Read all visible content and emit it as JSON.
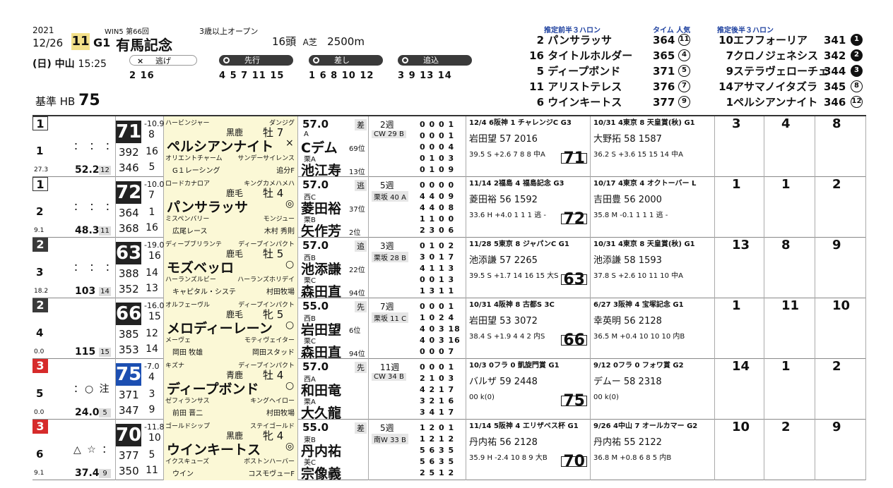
{
  "header": {
    "year": "2021",
    "date": "12/26",
    "win5": "WIN5",
    "win5_count": "第66回",
    "race_number": "11",
    "grade": "G1",
    "race_name": "有馬記念",
    "condition": "3歳以上オープン",
    "field": "16頭",
    "surface": "A芝",
    "distance": "2500m",
    "venue": "(日) 中山",
    "post_time": "15:25",
    "basis_label": "基準 HB",
    "basis_value": "75"
  },
  "styles": [
    {
      "label": "逃げ",
      "runners": "2  16"
    },
    {
      "label": "先行",
      "runners": "4  5  7  11 15"
    },
    {
      "label": "差し",
      "runners": "1  6  8  10 12"
    },
    {
      "label": "追込",
      "runners": "3  9  13 14"
    }
  ],
  "early_pace": {
    "heading": "推定前半３ハロン",
    "rows": [
      {
        "no": "2",
        "name": "パンサラッサ"
      },
      {
        "no": "16",
        "name": "タイトルホルダー"
      },
      {
        "no": "5",
        "name": "ディープボンド"
      },
      {
        "no": "11",
        "name": "アリストテレス"
      },
      {
        "no": "6",
        "name": "ウインキートス"
      }
    ]
  },
  "time_pop": {
    "heading": "タイム 人気",
    "rows": [
      {
        "time": "364",
        "pop": "11"
      },
      {
        "time": "365",
        "pop": "4"
      },
      {
        "time": "371",
        "pop": "5"
      },
      {
        "time": "376",
        "pop": "7"
      },
      {
        "time": "377",
        "pop": "9"
      }
    ]
  },
  "late_pace": {
    "heading": "推定後半３ハロン",
    "rows": [
      {
        "no": "10",
        "name": "エフフォーリア",
        "time": "341",
        "rank": "1"
      },
      {
        "no": "7",
        "name": "クロノジェネシス",
        "time": "342",
        "rank": "2"
      },
      {
        "no": "9",
        "name": "ステラヴェローチェ",
        "time": "344",
        "rank": "3"
      },
      {
        "no": "14",
        "name": "アサマノイタズラ",
        "time": "345",
        "rank": "8"
      },
      {
        "no": "1",
        "name": "ペルシアンナイト",
        "time": "346",
        "rank": "12"
      }
    ]
  },
  "colors": {
    "waku1": "#ffffff",
    "waku2": "#3a3a3a",
    "waku3": "#d62b2b",
    "waku4": "#1c4fb2",
    "highlight": "#fbf8d6"
  },
  "horses": [
    {
      "waku": "1",
      "no": "1",
      "marks": "： ： ：",
      "odds": "52.2",
      "pop": "12",
      "odds_idx": "27.3",
      "rating": "71",
      "r1": "-10.9",
      "r1b": "8",
      "r2": "392",
      "r2b": "16",
      "r3": "346",
      "r3b": "5",
      "sire": "ハービンジャー",
      "dam_sire": "ダンジグ",
      "coat": "黒鹿",
      "sex_age": "牡 7",
      "name": "ペルシアンナイト",
      "mark": "×",
      "dam": "オリエントチャーム",
      "owner_sire": "サンデーサイレンス",
      "owner": "G１レーシング",
      "breeder": "追分F",
      "weight": "57.0",
      "style": "差",
      "jockey_pre": "A",
      "jockey": "Cデム",
      "j_rank": "69位",
      "trainer_pre": "栗A",
      "trainer": "池江寿",
      "t_rank": "13位",
      "interval": "2週",
      "course": "CW 29 B",
      "rec": [
        "0 0 0 1",
        "0 0 0 1",
        "0 0 0 4",
        "0 1 0 3",
        "0 1 0 9"
      ],
      "past1": "12/4 6阪神 1 チャレンジC G3",
      "past1b": "岩田望 57 2016",
      "past1c": "39.5 S +2.6 7 8 8 中A",
      "past2": "10/31 4東京 8 天皇賞(秋) G1",
      "past2b": "大野拓 58 1587",
      "past2c": "36.2 S +3.6 15 15 14 中A",
      "f1": "3",
      "f2": "4",
      "f3": "8"
    },
    {
      "waku": "1",
      "no": "2",
      "marks": "： ： ：",
      "odds": "48.3",
      "pop": "11",
      "odds_idx": "9.1",
      "rating": "72",
      "r1": "-10.0",
      "r1b": "7",
      "r2": "364",
      "r2b": "1",
      "r3": "368",
      "r3b": "16",
      "sire": "ロードカナロア",
      "dam_sire": "キングカメハメハ",
      "coat": "鹿毛",
      "sex_age": "牡 4",
      "name": "パンサラッサ",
      "mark": "◎",
      "dam": "ミスペンバリー",
      "owner_sire": "モンジュー",
      "owner": "広尾レース",
      "breeder": "木村 秀則",
      "weight": "57.0",
      "style": "逃",
      "jockey_pre": "西C",
      "jockey": "菱田裕",
      "j_rank": "37位",
      "trainer_pre": "栗B",
      "trainer": "矢作芳",
      "t_rank": "2位",
      "interval": "5週",
      "course": "栗坂 40 A",
      "rec": [
        "0 0 0 0",
        "4 4 0 9",
        "4 4 0 8",
        "1 1 0 0",
        "2 3 0 6"
      ],
      "past1": "11/14 2福島 4 福島記念 G3",
      "past1b": "菱田裕 56 1592",
      "past1c": "33.6 H +4.0 1 1 1 逃 -",
      "past2": "10/17 4東京 4 オクトーバー L",
      "past2b": "吉田豊 56 2000",
      "past2c": "35.8 M -0.1 1 1 1 逃 -",
      "f1": "1",
      "f2": "1",
      "f3": "2"
    },
    {
      "waku": "2",
      "no": "3",
      "marks": "： ： ：",
      "odds": "103",
      "pop": "14",
      "odds_idx": "18.2",
      "rating": "63",
      "r1": "-19.0",
      "r1b": "16",
      "r2": "388",
      "r2b": "14",
      "r3": "352",
      "r3b": "13",
      "sire": "ディープブリランテ",
      "dam_sire": "ディープインパクト",
      "coat": "鹿毛",
      "sex_age": "牡 5",
      "name": "モズベッロ",
      "mark": "○",
      "dam": "ハーランズルビー",
      "owner_sire": "ハーランズホリデイ",
      "owner": "キャピタル・システ",
      "breeder": "村田牧場",
      "weight": "57.0",
      "style": "追",
      "jockey_pre": "西B",
      "jockey": "池添謙",
      "j_rank": "22位",
      "trainer_pre": "栗C",
      "trainer": "森田直",
      "t_rank": "94位",
      "interval": "3週",
      "course": "栗坂 28 B",
      "rec": [
        "0 1 0 2",
        "3 0 1 7",
        "4 1 1 3",
        "0 0 1 3",
        "1 3 1 1"
      ],
      "past1": "11/28 5東京 8 ジャパンC G1",
      "past1b": "池添謙 57 2265",
      "past1c": "39.5 S +1.7 14 16 15 大S",
      "past2": "10/31 4東京 8 天皇賞(秋) G1",
      "past2b": "池添謙 58 1593",
      "past2c": "37.8 S +2.6 10 11 10 中A",
      "f1": "13",
      "f2": "8",
      "f3": "9"
    },
    {
      "waku": "2",
      "no": "4",
      "marks": "",
      "odds": "115",
      "pop": "15",
      "odds_idx": "0.0",
      "rating": "66",
      "r1": "-16.0",
      "r1b": "15",
      "r2": "385",
      "r2b": "12",
      "r3": "353",
      "r3b": "14",
      "sire": "オルフェーヴル",
      "dam_sire": "ディープインパクト",
      "coat": "鹿毛",
      "sex_age": "牝 5",
      "name": "メロディーレーン",
      "mark": "○",
      "dam": "メーヴェ",
      "owner_sire": "モティヴェイター",
      "owner": "岡田 牧雄",
      "breeder": "岡田スタッド",
      "weight": "55.0",
      "style": "先",
      "jockey_pre": "西B",
      "jockey": "岩田望",
      "j_rank": "6位",
      "trainer_pre": "栗C",
      "trainer": "森田直",
      "t_rank": "94位",
      "interval": "7週",
      "course": "栗坂 11 C",
      "rec": [
        "0 0 0 1",
        "1 0 2 4",
        "4 0 3 18",
        "4 0 3 16",
        "0 0 0 7"
      ],
      "past1": "10/31 4阪神 8 古都S 3C",
      "past1b": "岩田望 53 3072",
      "past1c": "38.4 S +1.9 4 4 2 内S",
      "past2": "6/27 3阪神 4 宝塚記念 G1",
      "past2b": "幸英明 56 2128",
      "past2c": "36.5 M +0.4 10 10 10 内B",
      "f1": "1",
      "f2": "11",
      "f3": "10"
    },
    {
      "waku": "3",
      "no": "5",
      "marks": "：○ 注",
      "odds": "24.0",
      "pop": "5",
      "odds_idx": "0.0",
      "rating": "75",
      "r1": "-7.0",
      "r1b": "4",
      "r2": "371",
      "r2b": "3",
      "r3": "347",
      "r3b": "9",
      "sire": "キズナ",
      "dam_sire": "ディープインパクト",
      "coat": "青鹿",
      "sex_age": "牡 4",
      "name": "ディープボンド",
      "mark": "○",
      "dam": "ゼフィランサス",
      "owner_sire": "キングヘイロー",
      "owner": "前田 晋二",
      "breeder": "村田牧場",
      "weight": "57.0",
      "style": "先",
      "jockey_pre": "西A",
      "jockey": "和田竜",
      "j_rank": "",
      "trainer_pre": "栗A",
      "trainer": "大久龍",
      "t_rank": "",
      "interval": "11週",
      "course": "CW 34 B",
      "rec": [
        "0 0 0 1",
        "2 1 0 3",
        "4 2 1 7",
        "3 2 1 6",
        "3 4 1 7"
      ],
      "past1": "10/3 0フラ 0 凱旋門賞 G1",
      "past1b": "バルザ 59 2448",
      "past1c": "00 k(0)",
      "past2": "9/12 0フラ 0 フォワ賞 G2",
      "past2b": "デムー 58 2318",
      "past2c": "00 k(0)",
      "f1": "14",
      "f2": "1",
      "f3": "2"
    },
    {
      "waku": "3",
      "no": "6",
      "marks": "△ ☆ ：",
      "odds": "37.4",
      "pop": "9",
      "odds_idx": "9.1",
      "rating": "70",
      "r1": "-11.8",
      "r1b": "10",
      "r2": "377",
      "r2b": "5",
      "r3": "350",
      "r3b": "11",
      "sire": "ゴールドシップ",
      "dam_sire": "ステイゴールド",
      "coat": "黒鹿",
      "sex_age": "牝 4",
      "name": "ウインキートス",
      "mark": "◎",
      "dam": "イクスキューズ",
      "owner_sire": "ボストンハーバー",
      "owner": "ウイン",
      "breeder": "コスモヴューF",
      "weight": "55.0",
      "style": "差",
      "jockey_pre": "東B",
      "jockey": "丹内祐",
      "j_rank": "",
      "trainer_pre": "美C",
      "trainer": "宗像義",
      "t_rank": "",
      "interval": "5週",
      "course": "南W 33 B",
      "rec": [
        "1 2 0 1",
        "1 2 1 2",
        "5 6 3 5",
        "5 6 3 5",
        "2 5 1 2"
      ],
      "past1": "11/14 5阪神 4 エリザベス杯 G1",
      "past1b": "丹内祐 56 2128",
      "past1c": "35.9 H -2.4 10 8 9 大B",
      "past2": "9/26 4中山 7 オールカマー G2",
      "past2b": "丹内祐 55 2122",
      "past2c": "36.8 M +0.8 6 8 5 内B",
      "f1": "10",
      "f2": "2",
      "f3": "9"
    }
  ]
}
